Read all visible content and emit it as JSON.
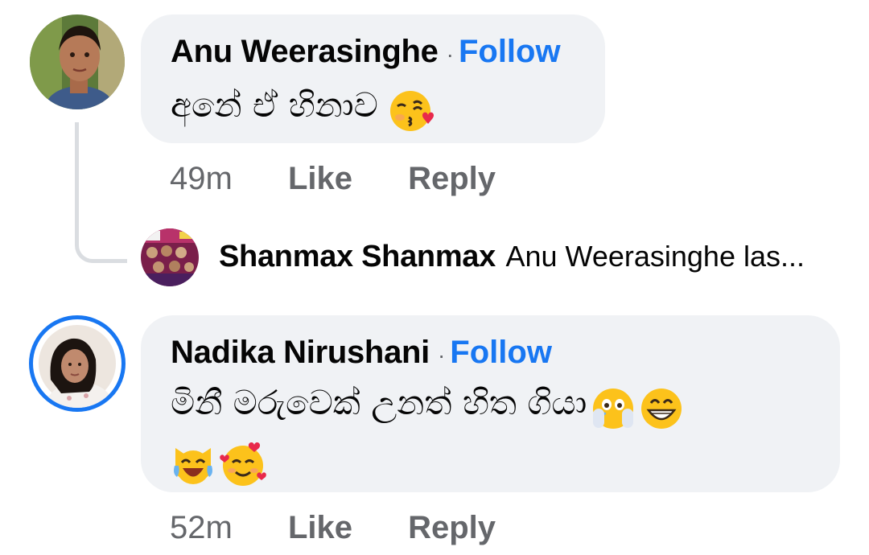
{
  "comments": [
    {
      "author": "Anu Weerasinghe",
      "separator": "·",
      "follow_label": "Follow",
      "text": "අනේ ඒ හිනාව",
      "emojis": [
        "face-blowing-kiss-emoji"
      ],
      "time": "49m",
      "like_label": "Like",
      "reply_label": "Reply"
    },
    {
      "author": "Nadika Nirushani",
      "separator": "·",
      "follow_label": "Follow",
      "text": "මිනී මරුවෙක් උනත් හිත ගියා",
      "emojis": [
        "face-hands-over-mouth-emoji",
        "grinning-face-emoji",
        "cat-tears-of-joy-emoji",
        "smiling-face-with-hearts-emoji"
      ],
      "time": "52m",
      "like_label": "Like",
      "reply_label": "Reply"
    }
  ],
  "reply_preview": {
    "author": "Shanmax Shanmax",
    "snippet": "Anu Weerasinghe las..."
  },
  "colors": {
    "bubble": "#f0f2f5",
    "follow": "#1877f2",
    "meta": "#65676b",
    "story_ring": "#1877f2"
  }
}
